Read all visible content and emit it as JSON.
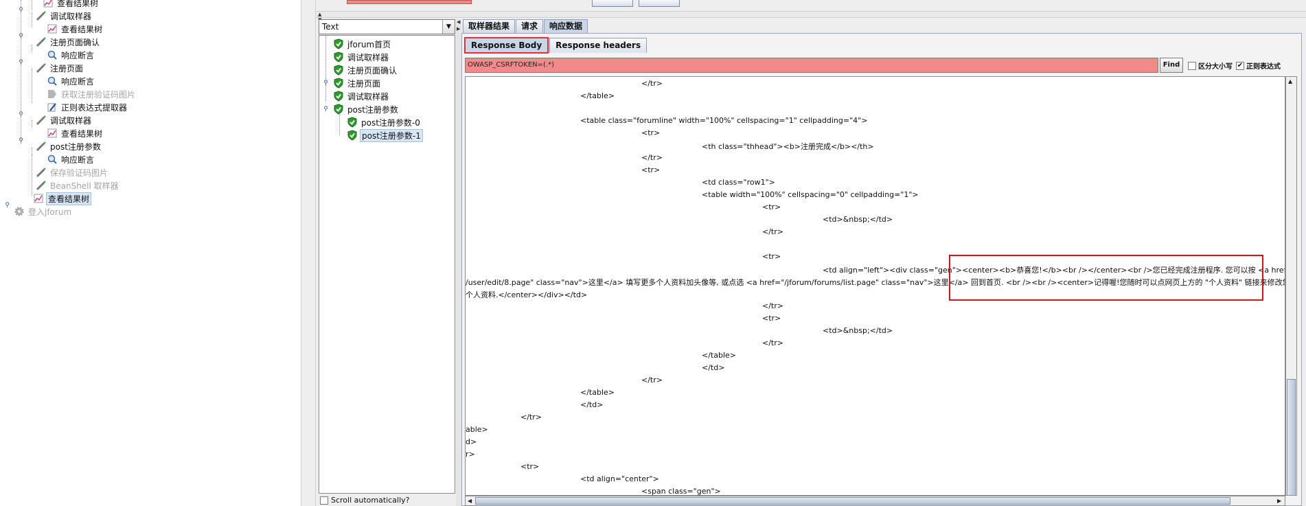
{
  "left_tree": {
    "items": [
      {
        "label": "查看结果树",
        "icon": "listener-icon",
        "disabled": false,
        "selected": false
      },
      {
        "label": "调试取样器",
        "icon": "sampler-icon",
        "disabled": false,
        "selected": false
      },
      {
        "label": "查看结果树",
        "icon": "listener-icon",
        "disabled": false,
        "selected": false
      },
      {
        "label": "注册页面确认",
        "icon": "sampler-icon",
        "disabled": false,
        "selected": false
      },
      {
        "label": "响应断言",
        "icon": "assertion-icon",
        "disabled": false,
        "selected": false
      },
      {
        "label": "注册页面",
        "icon": "sampler-icon",
        "disabled": false,
        "selected": false
      },
      {
        "label": "响应断言",
        "icon": "assertion-icon",
        "disabled": false,
        "selected": false
      },
      {
        "label": "获取注册验证码图片",
        "icon": "post-processor-icon",
        "disabled": true,
        "selected": false
      },
      {
        "label": "正则表达式提取器",
        "icon": "extractor-icon",
        "disabled": false,
        "selected": false
      },
      {
        "label": "调试取样器",
        "icon": "sampler-icon",
        "disabled": false,
        "selected": false
      },
      {
        "label": "查看结果树",
        "icon": "listener-icon",
        "disabled": false,
        "selected": false
      },
      {
        "label": "post注册参数",
        "icon": "sampler-icon",
        "disabled": false,
        "selected": false
      },
      {
        "label": "响应断言",
        "icon": "assertion-icon",
        "disabled": false,
        "selected": false
      },
      {
        "label": "保存验证码图片",
        "icon": "sampler-icon",
        "disabled": true,
        "selected": false
      },
      {
        "label": "BeanShell 取样器",
        "icon": "sampler-icon",
        "disabled": true,
        "selected": false
      },
      {
        "label": "查看结果树",
        "icon": "listener-icon",
        "disabled": false,
        "selected": true
      },
      {
        "label": "登入jforum",
        "icon": "gear-icon",
        "disabled": true,
        "selected": false
      }
    ]
  },
  "renderer": {
    "value": "Text"
  },
  "result_tree": {
    "items": [
      {
        "label": "jforum首页",
        "selected": false
      },
      {
        "label": "调试取样器",
        "selected": false
      },
      {
        "label": "注册页面确认",
        "selected": false
      },
      {
        "label": "注册页面",
        "selected": false
      },
      {
        "label": "调试取样器",
        "selected": false
      },
      {
        "label": "post注册参数",
        "selected": false
      },
      {
        "label": "post注册参数-0",
        "selected": false
      },
      {
        "label": "post注册参数-1",
        "selected": true
      }
    ],
    "scroll_auto_label": "Scroll automatically?"
  },
  "tabs": [
    "取样器结果",
    "请求",
    "响应数据"
  ],
  "subtabs": [
    "Response Body",
    "Response headers"
  ],
  "find": {
    "value": "OWASP_CSRFTOKEN=(.*)",
    "button": "Find",
    "case_label": "区分大小写",
    "case_checked": false,
    "regex_label": "正则表达式",
    "regex_checked": true
  },
  "body_lines": [
    "</tr>",
    "</table>",
    "",
    "<table class=\"forumline\" width=\"100%\" cellspacing=\"1\" cellpadding=\"4\">",
    "<tr>",
    "<th class=\"thhead\"><b>注册完成</b></th>",
    "</tr>",
    "<tr>",
    "<td class=\"row1\">",
    "<table width=\"100%\" cellspacing=\"0\" cellpadding=\"1\">",
    "<tr>",
    "<td>&nbsp;</td>",
    "</tr>",
    "",
    "<tr>",
    "<td align=\"left\"><div class=\"gen\"><center><b>恭喜您!</b><br /></center><br />您已经完成注册程序. 您可以按 <a href=\"/jforu",
    "/user/edit/8.page\" class=\"nav\">这里</a> 填写更多个人资料加头像等, 或点选 <a href=\"/jforum/forums/list.page\" class=\"nav\">这里</a> 回到首页. <br /><br /><center>记得喔!您随时可以点网页上方的 \"个人资料\" 链接来修改您",
    "个人资料.</center></div></td>",
    "</tr>",
    "<tr>",
    "<td>&nbsp;</td>",
    "</tr>",
    "</table>",
    "</td>",
    "</tr>",
    "</table>",
    "</td>",
    "</tr>",
    "able>",
    "d>",
    "r>",
    "<tr>",
    "<td align=\"center\">",
    "<span class=\"gen\">"
  ]
}
